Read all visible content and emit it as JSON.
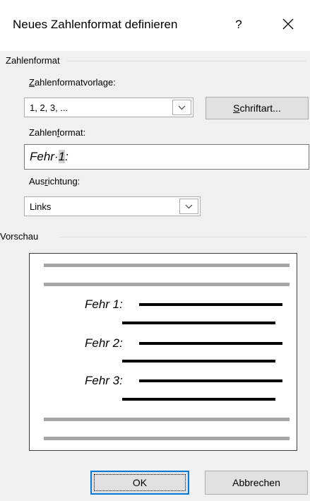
{
  "dialog": {
    "title": "Neues Zahlenformat definieren",
    "help": "?",
    "close_icon": "close-icon"
  },
  "group_number_format": {
    "label": "Zahlenformat",
    "style_label_prefix": "",
    "style_label_underline": "Z",
    "style_label_rest": "ahlenformatvorlage:",
    "style_value": "1, 2, 3, ...",
    "font_button_underline": "S",
    "font_button_rest": "chriftart...",
    "format_label_before": "Zahlen",
    "format_label_underline": "f",
    "format_label_after": "ormat:",
    "format_value_before": "Fehr·",
    "format_value_highlight": "1",
    "format_value_after": ":",
    "alignment_label_before": "Aus",
    "alignment_label_underline": "r",
    "alignment_label_after": "ichtung:",
    "alignment_value": "Links"
  },
  "group_preview": {
    "label": "Vorschau",
    "items": [
      "Fehr 1:",
      "Fehr 2:",
      "Fehr 3:"
    ]
  },
  "buttons": {
    "ok": "OK",
    "cancel": "Abbrechen"
  },
  "colors": {
    "accent": "#0078d7",
    "preview_gray": "#a6a6a6"
  }
}
